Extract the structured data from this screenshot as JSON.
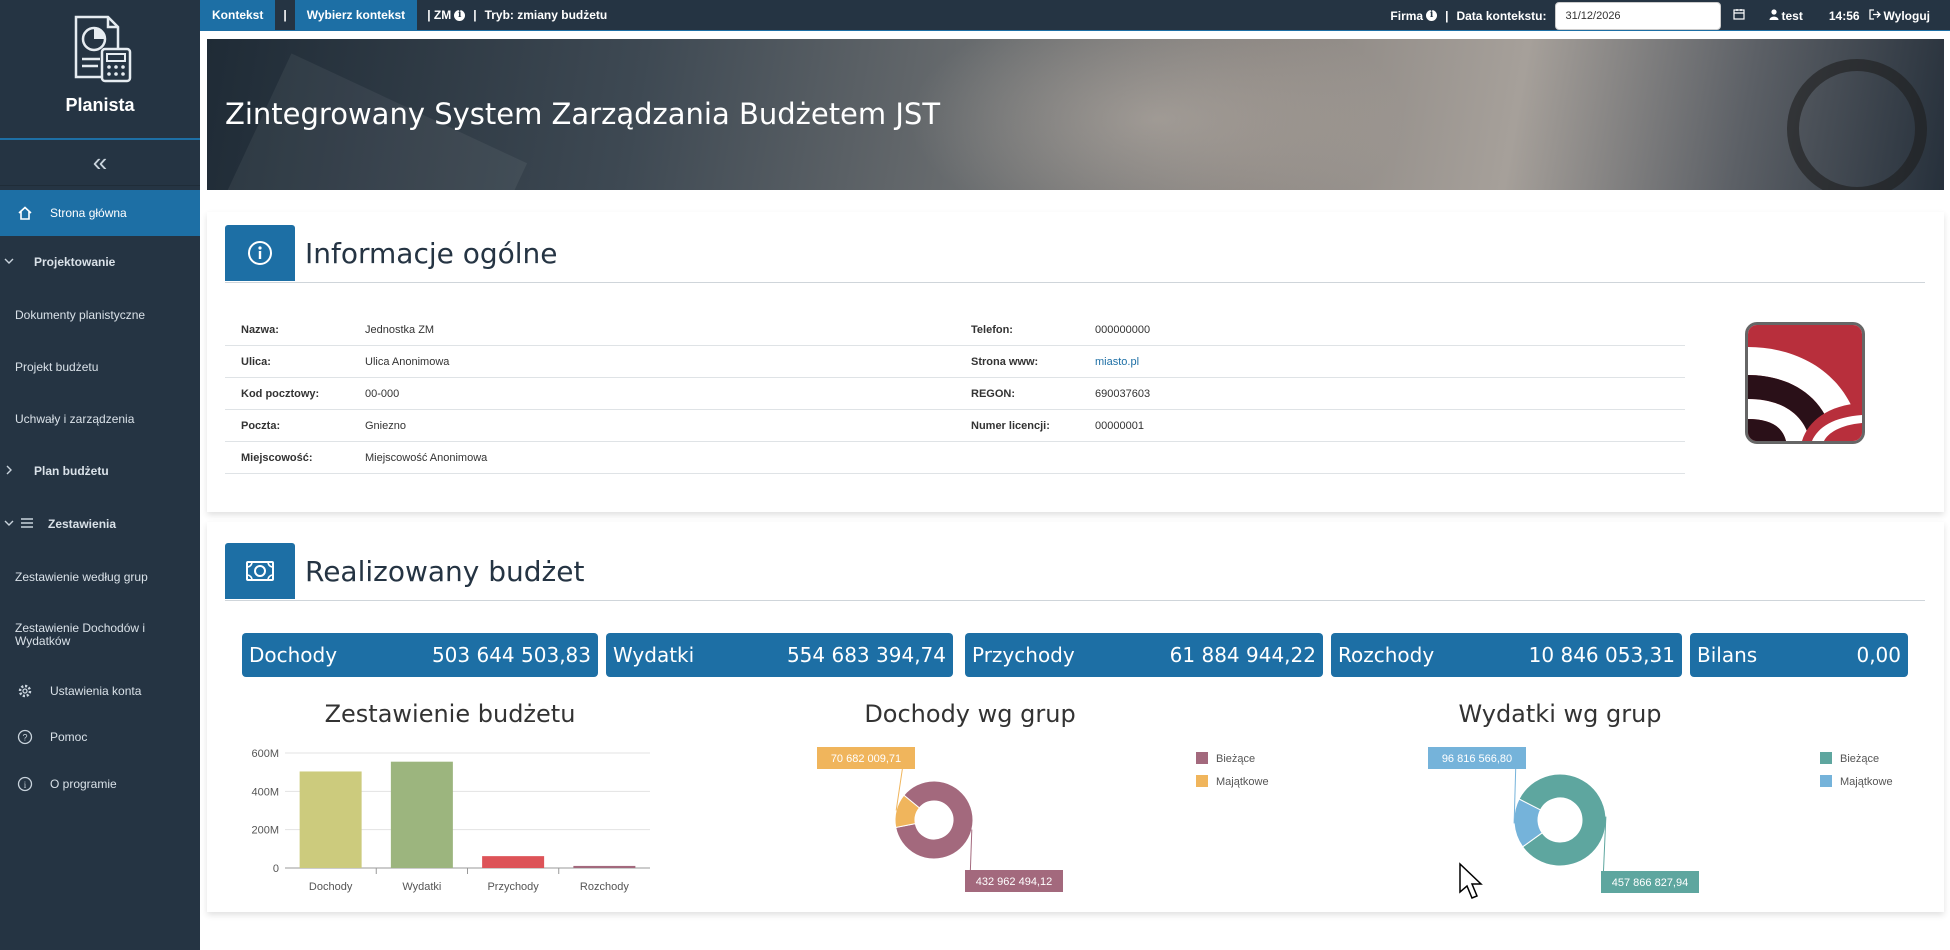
{
  "sidebar": {
    "brand": "Planista",
    "collapse_icon": "«",
    "items": [
      {
        "label": "Strona główna",
        "icon": "home-icon",
        "active": true
      },
      {
        "label": "Projektowanie",
        "icon": "chevron-down-icon"
      },
      {
        "label": "Dokumenty planistyczne"
      },
      {
        "label": "Projekt budżetu"
      },
      {
        "label": "Uchwały i zarządzenia"
      },
      {
        "label": "Plan budżetu",
        "icon": "chevron-right-icon"
      },
      {
        "label": "Zestawienia",
        "icon": "menu-icon"
      },
      {
        "label": "Zestawienie według grup"
      },
      {
        "label": "Zestawienie Dochodów i Wydatków"
      },
      {
        "label": "Ustawienia konta",
        "icon": "gear-icon"
      },
      {
        "label": "Pomoc",
        "icon": "help-icon"
      },
      {
        "label": "O programie",
        "icon": "info-icon"
      }
    ]
  },
  "topbar": {
    "context_label": "Kontekst",
    "sep": "|",
    "choose_context": "Wybierz kontekst",
    "unit": "| ZM",
    "mode": "Tryb: zmiany budżetu",
    "company": "Firma",
    "date_label": "Data kontekstu:",
    "date_value": "31/12/2026",
    "user": "test",
    "time": "14:56",
    "logout": "Wyloguj"
  },
  "banner": {
    "title": "Zintegrowany System Zarządzania Budżetem JST"
  },
  "general_info": {
    "title": "Informacje ogólne",
    "left": [
      {
        "label": "Nazwa:",
        "value": "Jednostka ZM"
      },
      {
        "label": "Ulica:",
        "value": "Ulica Anonimowa"
      },
      {
        "label": "Kod pocztowy:",
        "value": "00-000"
      },
      {
        "label": "Poczta:",
        "value": "Gniezno"
      },
      {
        "label": "Miejscowość:",
        "value": "Miejscowość Anonimowa"
      }
    ],
    "right": [
      {
        "label": "Telefon:",
        "value": "000000000"
      },
      {
        "label": "Strona www:",
        "value": "miasto.pl"
      },
      {
        "label": "REGON:",
        "value": "690037603"
      },
      {
        "label": "Numer licencji:",
        "value": "00000001"
      }
    ]
  },
  "budget": {
    "title": "Realizowany budżet",
    "summary": [
      {
        "label": "Dochody",
        "value": "503 644 503,83"
      },
      {
        "label": "Wydatki",
        "value": "554 683 394,74"
      },
      {
        "label": "Przychody",
        "value": "61 884 944,22"
      },
      {
        "label": "Rozchody",
        "value": "10 846 053,31"
      },
      {
        "label": "Bilans",
        "value": "0,00"
      }
    ]
  },
  "colors": {
    "accent": "#1d6fa5",
    "sidebar": "#253443",
    "majatkowe_income": "#f0b55c",
    "biezace_income": "#a3697d",
    "biezace_exp": "#5ea69f",
    "majatkowe_exp": "#75b3da"
  },
  "chart_data": [
    {
      "type": "bar",
      "title": "Zestawienie budżetu",
      "categories": [
        "Dochody",
        "Wydatki",
        "Przychody",
        "Rozchody"
      ],
      "values": [
        503644503.83,
        554683394.74,
        61884944.22,
        10846053.31
      ],
      "colors": [
        "#cccb7d",
        "#9cb57e",
        "#dd5358",
        "#a3697d"
      ],
      "yticks": [
        "0",
        "200M",
        "400M",
        "600M"
      ],
      "ylim": [
        0,
        600000000
      ],
      "grid": true
    },
    {
      "type": "pie",
      "title": "Dochody wg grup",
      "series": [
        {
          "name": "Bieżące",
          "value": 432962494.12,
          "label": "432 962 494,12",
          "color": "#a3697d"
        },
        {
          "name": "Majątkowe",
          "value": 70682009.71,
          "label": "70 682 009,71",
          "color": "#f0b55c"
        }
      ],
      "legend": "top-right"
    },
    {
      "type": "pie",
      "title": "Wydatki wg grup",
      "series": [
        {
          "name": "Bieżące",
          "value": 457866827.94,
          "label": "457 866 827,94",
          "color": "#5ea69f"
        },
        {
          "name": "Majątkowe",
          "value": 96816566.8,
          "label": "96 816 566,80",
          "color": "#75b3da"
        }
      ],
      "legend": "top-right"
    }
  ]
}
